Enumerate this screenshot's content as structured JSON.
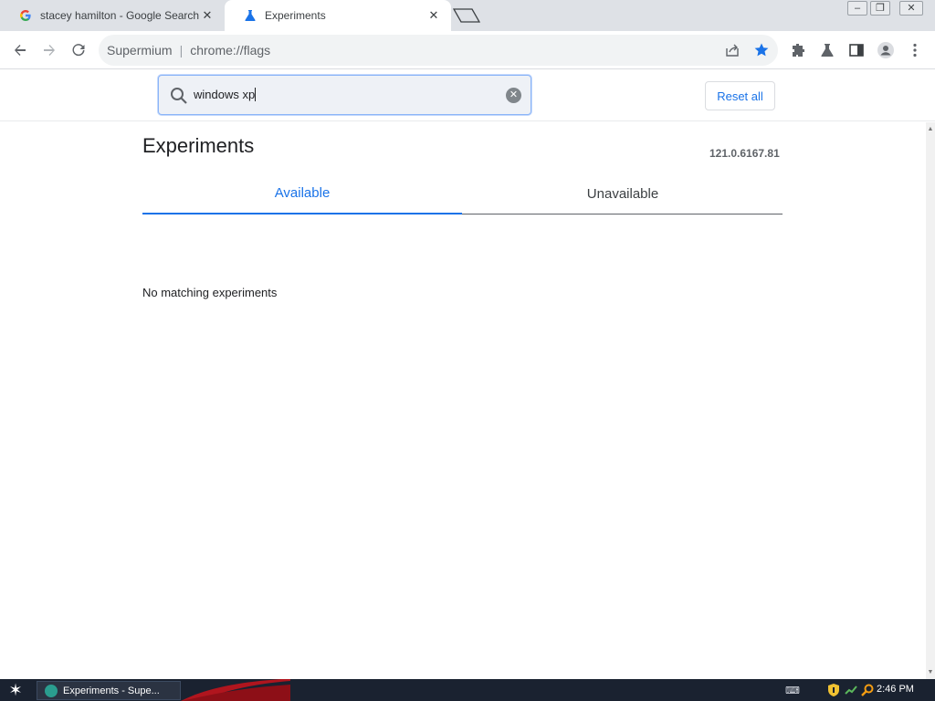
{
  "browser": {
    "tabs": [
      {
        "title": "stacey hamilton - Google Search",
        "icon": "google-g-icon",
        "active": false
      },
      {
        "title": "Experiments",
        "icon": "flask-icon",
        "active": true
      }
    ],
    "omnibox": {
      "brand": "Supermium",
      "url": "chrome://flags"
    }
  },
  "flags": {
    "search": {
      "value": "windows xp",
      "placeholder": "Search flags"
    },
    "reset_label": "Reset all",
    "title": "Experiments",
    "version": "121.0.6167.81",
    "tabs": [
      {
        "label": "Available",
        "active": true
      },
      {
        "label": "Unavailable",
        "active": false
      }
    ],
    "empty_message": "No matching experiments"
  },
  "taskbar": {
    "task_label": "Experiments - Supe...",
    "clock": "2:46 PM"
  },
  "colors": {
    "accent": "#1a73e8",
    "tabstrip": "#dee1e6",
    "taskbar": "#1a2230"
  }
}
